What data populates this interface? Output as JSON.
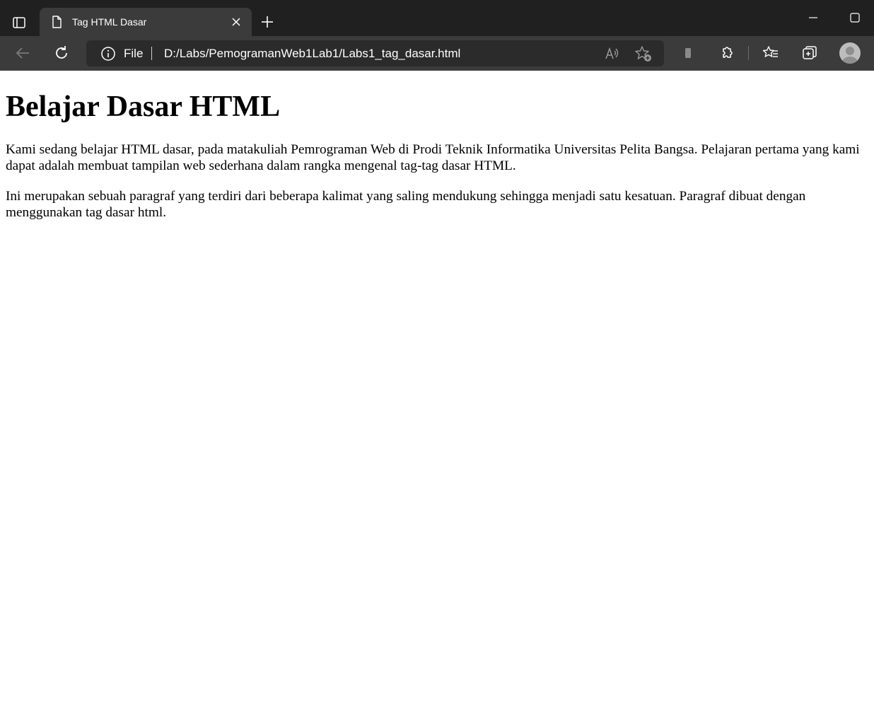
{
  "browser": {
    "tab": {
      "title": "Tag HTML Dasar"
    },
    "address_bar": {
      "scheme_label": "File",
      "url": "D:/Labs/PemogramanWeb1Lab1/Labs1_tag_dasar.html"
    },
    "icons": {
      "tab_actions": "tab-actions-icon",
      "favicon": "page-icon",
      "close_tab": "close-icon",
      "new_tab": "plus-icon",
      "minimize": "minimize-icon",
      "maximize": "maximize-icon",
      "back": "back-arrow-icon",
      "refresh": "refresh-icon",
      "site_info": "info-icon",
      "read_aloud": "read-aloud-icon",
      "add_favorite": "add-favorite-icon",
      "app_available": "app-icon",
      "extensions": "puzzle-icon",
      "favorites": "favorites-icon",
      "collections": "collections-icon",
      "profile": "profile-avatar"
    },
    "colors": {
      "titlebar": "#202020",
      "toolbar": "#3b3b3b",
      "addressbar": "#2b2b2b"
    }
  },
  "page": {
    "heading": "Belajar Dasar HTML",
    "paragraphs": [
      "Kami sedang belajar HTML dasar, pada matakuliah Pemrograman Web di Prodi Teknik Informatika Universitas Pelita Bangsa. Pelajaran pertama yang kami dapat adalah membuat tampilan web sederhana dalam rangka mengenal tag-tag dasar HTML.",
      "Ini merupakan sebuah paragraf yang terdiri dari beberapa kalimat yang saling mendukung sehingga menjadi satu kesatuan. Paragraf dibuat dengan menggunakan tag dasar html."
    ]
  }
}
